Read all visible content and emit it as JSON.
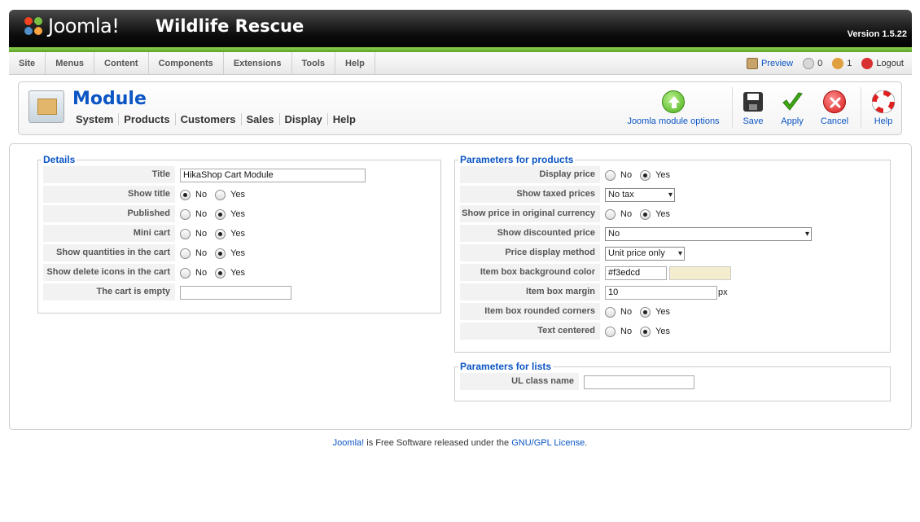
{
  "header": {
    "logo_text": "Joomla!",
    "site_title": "Wildlife Rescue",
    "version": "Version 1.5.22"
  },
  "menu": [
    "Site",
    "Menus",
    "Content",
    "Components",
    "Extensions",
    "Tools",
    "Help"
  ],
  "status": {
    "preview": "Preview",
    "messages": "0",
    "users": "1",
    "logout": "Logout"
  },
  "toolbar": {
    "title": "Module",
    "submenu": [
      "System",
      "Products",
      "Customers",
      "Sales",
      "Display",
      "Help"
    ],
    "options_label": "Joomla module options",
    "save_label": "Save",
    "apply_label": "Apply",
    "cancel_label": "Cancel",
    "help_label": "Help"
  },
  "details": {
    "legend": "Details",
    "title_label": "Title",
    "title_value": "HikaShop Cart Module",
    "show_title_label": "Show title",
    "published_label": "Published",
    "mini_cart_label": "Mini cart",
    "show_quantities_label": "Show quantities in the cart",
    "show_delete_label": "Show delete icons in the cart",
    "cart_empty_label": "The cart is empty",
    "cart_empty_value": "",
    "no": "No",
    "yes": "Yes"
  },
  "products": {
    "legend": "Parameters for products",
    "display_price_label": "Display price",
    "show_taxed_label": "Show taxed prices",
    "show_taxed_value": "No tax",
    "show_original_label": "Show price in original currency",
    "show_discounted_label": "Show discounted price",
    "show_discounted_value": "No",
    "price_method_label": "Price display method",
    "price_method_value": "Unit price only",
    "bg_color_label": "Item box background color",
    "bg_color_value": "#f3edcd",
    "margin_label": "Item box margin",
    "margin_value": "10",
    "margin_unit": "px",
    "rounded_label": "Item box rounded corners",
    "text_centered_label": "Text centered",
    "no": "No",
    "yes": "Yes"
  },
  "lists": {
    "legend": "Parameters for lists",
    "ul_class_label": "UL class name",
    "ul_class_value": ""
  },
  "footer": {
    "joomla": "Joomla!",
    "middle": " is Free Software released under the ",
    "license": "GNU/GPL License",
    "end": "."
  },
  "colors": {
    "accent": "#0b55c4",
    "swatch": "#f3edcd",
    "header_green": "#6cbf3a"
  }
}
